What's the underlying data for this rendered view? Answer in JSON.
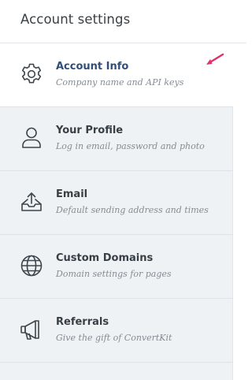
{
  "header": {
    "title": "Account settings"
  },
  "nav": {
    "items": [
      {
        "title": "Account Info",
        "description": "Company name and API keys",
        "icon": "gear-icon",
        "active": true
      },
      {
        "title": "Your Profile",
        "description": "Log in email, password and photo",
        "icon": "user-icon",
        "active": false
      },
      {
        "title": "Email",
        "description": "Default sending address and times",
        "icon": "inbox-upload-icon",
        "active": false
      },
      {
        "title": "Custom Domains",
        "description": "Domain settings for pages",
        "icon": "globe-icon",
        "active": false
      },
      {
        "title": "Referrals",
        "description": "Give the gift of ConvertKit",
        "icon": "megaphone-icon",
        "active": false
      }
    ]
  },
  "colors": {
    "active_title": "#2f4f7a",
    "nav_background": "#eef2f5",
    "annotation_arrow": "#e0306a"
  }
}
